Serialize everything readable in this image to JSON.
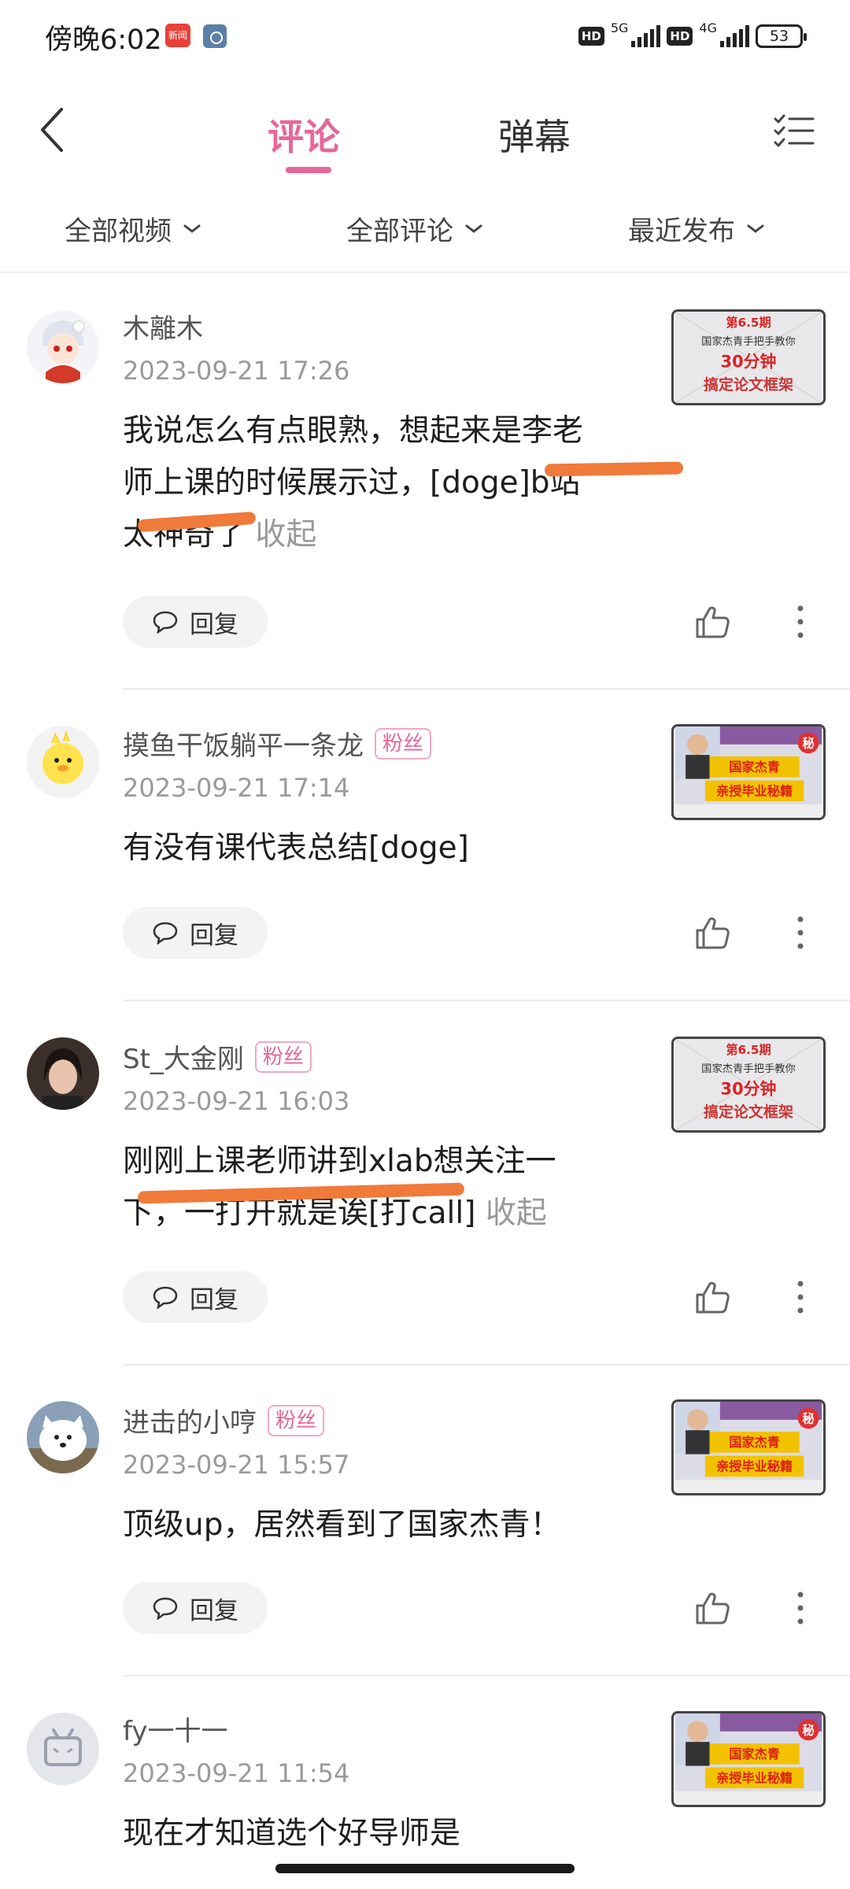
{
  "status_bar": {
    "time": "傍晚6:02",
    "app_icon_1_label": "新闻",
    "hd1": "HD",
    "network1": "5G",
    "hd2": "HD",
    "network2": "4G",
    "battery": "53"
  },
  "header": {
    "tab_comments": "评论",
    "tab_danmaku": "弹幕",
    "active_tab_color": "#e6679a"
  },
  "filters": {
    "videos": "全部视频",
    "comments": "全部评论",
    "sort": "最近发布"
  },
  "labels": {
    "reply": "回复",
    "collapse": "收起",
    "fan_badge": "粉丝"
  },
  "comments": [
    {
      "name": "木離木",
      "time": "2023-09-21 17:26",
      "text": "我说怎么有点眼熟，想起来是李老师上课的时候展示过，[doge]b站太神奇了",
      "collapsible": true,
      "fan": false,
      "thumb_title": "第6.5期",
      "thumb_line1": "国家杰青手把手教你",
      "thumb_line2": "30分钟",
      "thumb_line3": "搞定论文框架"
    },
    {
      "name": "摸鱼干饭躺平一条龙",
      "time": "2023-09-21 17:14",
      "text": "有没有课代表总结[doge]",
      "collapsible": false,
      "fan": true,
      "thumb_line1": "国家杰青",
      "thumb_line2": "亲授毕业秘籍",
      "thumb_badge": "秘"
    },
    {
      "name": "St_大金刚",
      "time": "2023-09-21 16:03",
      "text": "刚刚上课老师讲到xlab想关注一下，一打开就是诶[打call]",
      "collapsible": true,
      "fan": true,
      "thumb_title": "第6.5期",
      "thumb_line1": "国家杰青手把手教你",
      "thumb_line2": "30分钟",
      "thumb_line3": "搞定论文框架"
    },
    {
      "name": "进击的小哼",
      "time": "2023-09-21 15:57",
      "text": "顶级up，居然看到了国家杰青！",
      "collapsible": false,
      "fan": true,
      "thumb_line1": "国家杰青",
      "thumb_line2": "亲授毕业秘籍",
      "thumb_badge": "秘"
    },
    {
      "name": "fy一十一",
      "time": "2023-09-21 11:54",
      "text": "现在才知道选个好导师是",
      "collapsible": false,
      "fan": false,
      "thumb_line1": "国家杰青",
      "thumb_line2": "亲授毕业秘籍",
      "thumb_badge": "秘"
    }
  ],
  "colors": {
    "accent": "#e6679a",
    "annotation": "#f07a3a"
  }
}
